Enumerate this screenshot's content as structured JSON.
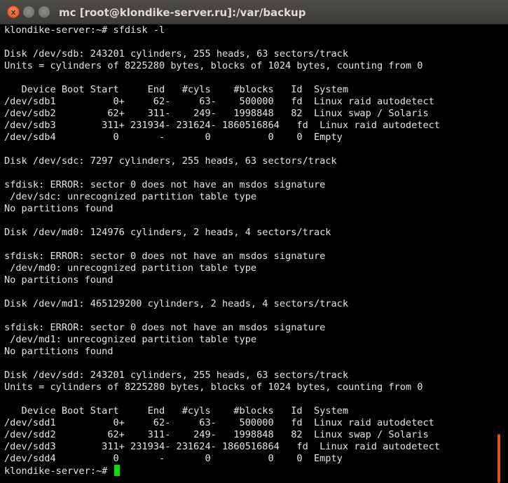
{
  "window": {
    "title": "mc [root@klondike-server.ru]:/var/backup",
    "close_label": "x",
    "minimize_label": "",
    "maximize_label": ""
  },
  "terminal": {
    "lines": [
      "klondike-server:~# sfdisk -l",
      "",
      "Disk /dev/sdb: 243201 cylinders, 255 heads, 63 sectors/track",
      "Units = cylinders of 8225280 bytes, blocks of 1024 bytes, counting from 0",
      "",
      "   Device Boot Start     End   #cyls    #blocks   Id  System",
      "/dev/sdb1          0+     62-     63-    500000   fd  Linux raid autodetect",
      "/dev/sdb2         62+    311-    249-   1998848   82  Linux swap / Solaris",
      "/dev/sdb3        311+ 231934- 231624- 1860516864   fd  Linux raid autodetect",
      "/dev/sdb4          0       -       0          0    0  Empty",
      "",
      "Disk /dev/sdc: 7297 cylinders, 255 heads, 63 sectors/track",
      "",
      "sfdisk: ERROR: sector 0 does not have an msdos signature",
      " /dev/sdc: unrecognized partition table type",
      "No partitions found",
      "",
      "Disk /dev/md0: 124976 cylinders, 2 heads, 4 sectors/track",
      "",
      "sfdisk: ERROR: sector 0 does not have an msdos signature",
      " /dev/md0: unrecognized partition table type",
      "No partitions found",
      "",
      "Disk /dev/md1: 465129200 cylinders, 2 heads, 4 sectors/track",
      "",
      "sfdisk: ERROR: sector 0 does not have an msdos signature",
      " /dev/md1: unrecognized partition table type",
      "No partitions found",
      "",
      "Disk /dev/sdd: 243201 cylinders, 255 heads, 63 sectors/track",
      "Units = cylinders of 8225280 bytes, blocks of 1024 bytes, counting from 0",
      "",
      "   Device Boot Start     End   #cyls    #blocks   Id  System",
      "/dev/sdd1          0+     62-     63-    500000   fd  Linux raid autodetect",
      "/dev/sdd2         62+    311-    249-   1998848   82  Linux swap / Solaris",
      "/dev/sdd3        311+ 231934- 231624- 1860516864   fd  Linux raid autodetect",
      "/dev/sdd4          0       -       0          0    0  Empty"
    ],
    "prompt": "klondike-server:~# "
  },
  "colors": {
    "terminal_bg": "#000000",
    "terminal_fg": "#e4e4e4",
    "cursor": "#00e000",
    "titlebar": "#3c3b37",
    "close_button": "#e0521f"
  }
}
